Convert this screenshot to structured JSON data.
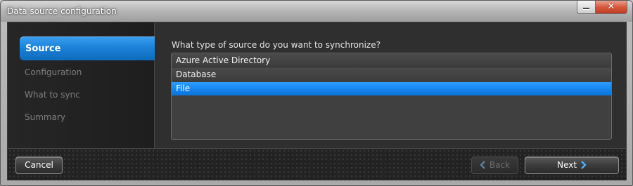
{
  "window": {
    "title": "Data source configuration",
    "close_glyph": "✕"
  },
  "sidebar": {
    "items": [
      {
        "label": "Source",
        "active": true
      },
      {
        "label": "Configuration",
        "active": false
      },
      {
        "label": "What to sync",
        "active": false
      },
      {
        "label": "Summary",
        "active": false
      }
    ]
  },
  "main": {
    "question": "What type of source do you want to synchronize?",
    "options": [
      "Azure Active Directory",
      "Database",
      "File"
    ],
    "selected": "File"
  },
  "footer": {
    "cancel_label": "Cancel",
    "back_label": "Back",
    "next_label": "Next"
  },
  "colors": {
    "accent": "#1584ec",
    "panel": "#2f2f2f",
    "close": "#c23b22"
  },
  "icons": {
    "back": "chevron-left-icon",
    "next": "chevron-right-icon"
  }
}
